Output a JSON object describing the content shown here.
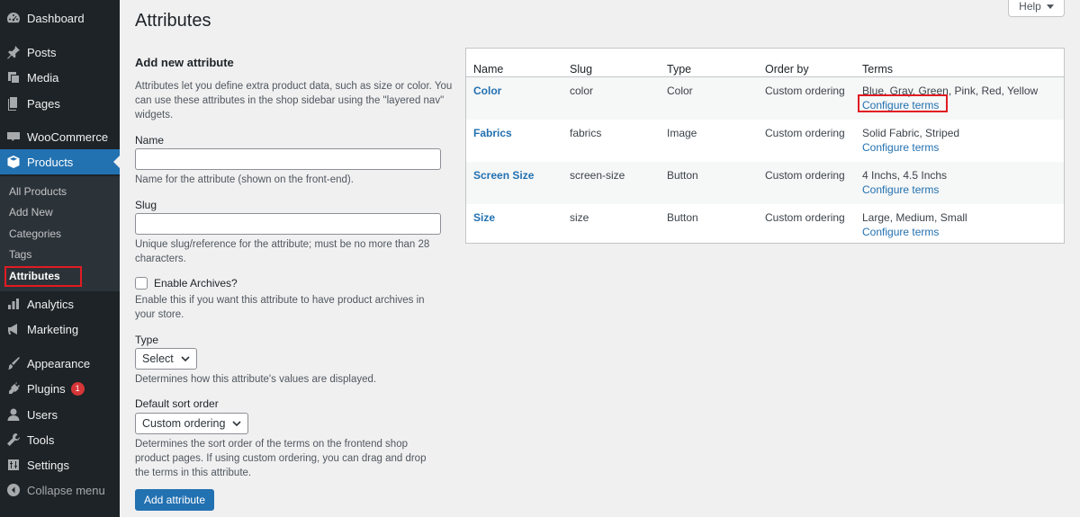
{
  "page": {
    "title": "Attributes",
    "help_label": "Help"
  },
  "sidebar": {
    "items": [
      {
        "label": "Dashboard",
        "icon": "dashboard-icon"
      },
      {
        "label": "Posts",
        "icon": "pushpin-icon"
      },
      {
        "label": "Media",
        "icon": "media-icon"
      },
      {
        "label": "Pages",
        "icon": "pages-icon"
      },
      {
        "label": "WooCommerce",
        "icon": "woo-icon"
      },
      {
        "label": "Products",
        "icon": "archive-box-icon"
      },
      {
        "label": "Analytics",
        "icon": "bar-chart-icon"
      },
      {
        "label": "Marketing",
        "icon": "megaphone-icon"
      },
      {
        "label": "Appearance",
        "icon": "paintbrush-icon"
      },
      {
        "label": "Plugins",
        "icon": "plugin-icon",
        "badge": "1"
      },
      {
        "label": "Users",
        "icon": "user-icon"
      },
      {
        "label": "Tools",
        "icon": "wrench-icon"
      },
      {
        "label": "Settings",
        "icon": "settings-icon"
      },
      {
        "label": "Collapse menu",
        "icon": "collapse-icon"
      }
    ],
    "submenu": [
      "All Products",
      "Add New",
      "Categories",
      "Tags",
      "Attributes"
    ]
  },
  "form": {
    "heading": "Add new attribute",
    "intro": "Attributes let you define extra product data, such as size or color. You can use these attributes in the shop sidebar using the \"layered nav\" widgets.",
    "name_label": "Name",
    "name_help": "Name for the attribute (shown on the front-end).",
    "slug_label": "Slug",
    "slug_help": "Unique slug/reference for the attribute; must be no more than 28 characters.",
    "archives_label": "Enable Archives?",
    "archives_help": "Enable this if you want this attribute to have product archives in your store.",
    "type_label": "Type",
    "type_value": "Select",
    "type_help": "Determines how this attribute's values are displayed.",
    "sort_label": "Default sort order",
    "sort_value": "Custom ordering",
    "sort_help": "Determines the sort order of the terms on the frontend shop product pages. If using custom ordering, you can drag and drop the terms in this attribute.",
    "submit_label": "Add attribute"
  },
  "table": {
    "headers": [
      "Name",
      "Slug",
      "Type",
      "Order by",
      "Terms"
    ],
    "rows": [
      {
        "name": "Color",
        "slug": "color",
        "type": "Color",
        "order": "Custom ordering",
        "terms": "Blue, Gray, Green, Pink, Red, Yellow",
        "configure": "Configure terms"
      },
      {
        "name": "Fabrics",
        "slug": "fabrics",
        "type": "Image",
        "order": "Custom ordering",
        "terms": "Solid Fabric, Striped",
        "configure": "Configure terms"
      },
      {
        "name": "Screen Size",
        "slug": "screen-size",
        "type": "Button",
        "order": "Custom ordering",
        "terms": "4 Inchs, 4.5 Inchs",
        "configure": "Configure terms"
      },
      {
        "name": "Size",
        "slug": "size",
        "type": "Button",
        "order": "Custom ordering",
        "terms": "Large, Medium, Small",
        "configure": "Configure terms"
      }
    ]
  },
  "colors": {
    "accent": "#2271b1",
    "sidebar": "#1d2327",
    "highlight_box": "#e11b22"
  }
}
